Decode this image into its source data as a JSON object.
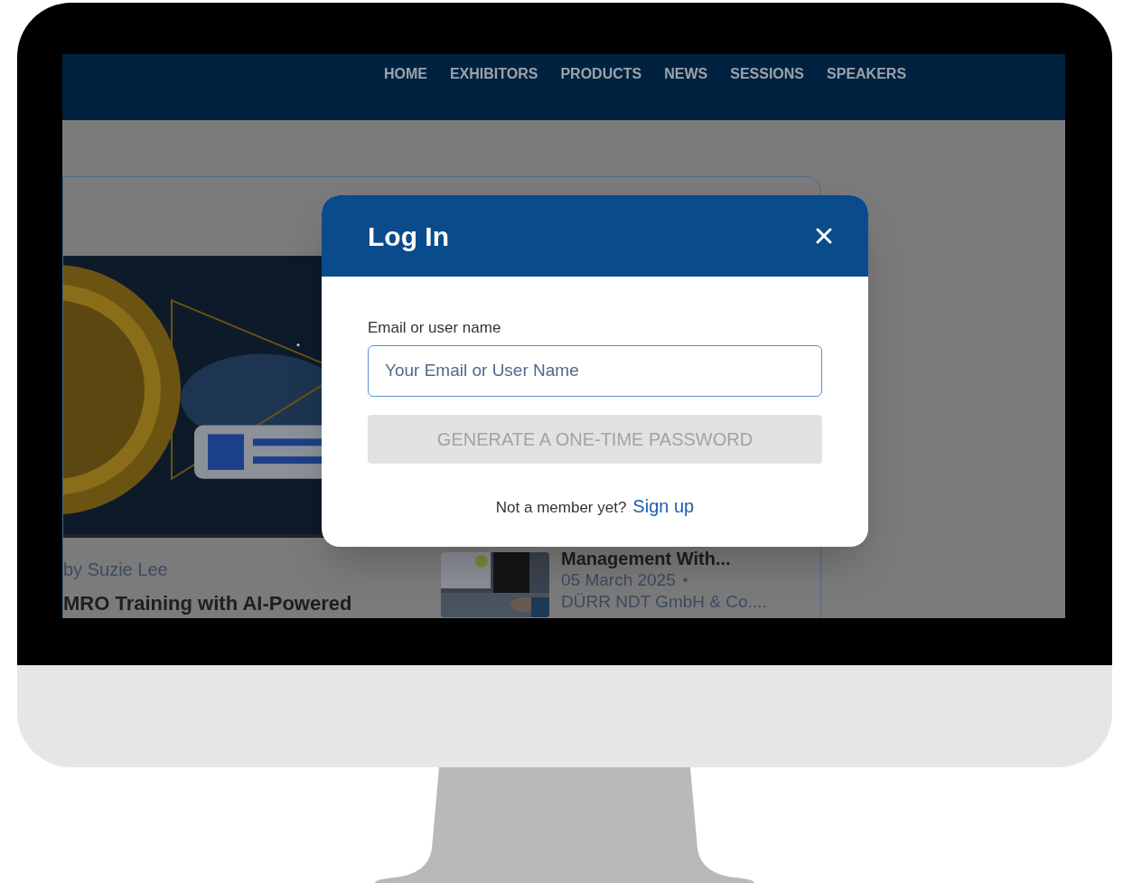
{
  "nav": {
    "items": [
      "HOME",
      "EXHIBITORS",
      "PRODUCTS",
      "NEWS",
      "SESSIONS",
      "SPEAKERS"
    ]
  },
  "articles": [
    {
      "kind": "feature",
      "byline": "by Suzie Lee",
      "title": "MRO Training with AI-Powered"
    },
    {
      "kind": "thumb",
      "title": "Management With...",
      "date": "05 March 2025",
      "separator": "•",
      "company": "DÜRR NDT GmbH & Co...."
    }
  ],
  "modal": {
    "title": "Log In",
    "field_label": "Email or user name",
    "placeholder": "Your Email or User Name",
    "button": {
      "label": "GENERATE A ONE-TIME PASSWORD",
      "disabled": true
    },
    "footer_text": "Not a member yet?",
    "footer_link": "Sign up"
  }
}
